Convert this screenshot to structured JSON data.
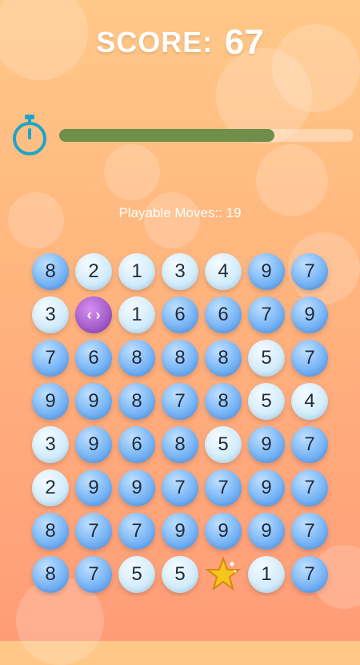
{
  "header": {
    "score_label": "SCORE:",
    "score_value": "67"
  },
  "timer": {
    "icon": "stopwatch-icon",
    "fill_fraction": 0.73,
    "fill_color": "#6e8e4a"
  },
  "moves": {
    "text": "Playable Moves:: 19"
  },
  "board": {
    "columns": 7,
    "rows": [
      [
        {
          "v": "8",
          "s": "dark"
        },
        {
          "v": "2",
          "s": "light"
        },
        {
          "v": "1",
          "s": "light"
        },
        {
          "v": "3",
          "s": "light"
        },
        {
          "v": "4",
          "s": "light"
        },
        {
          "v": "9",
          "s": "dark"
        },
        {
          "v": "7",
          "s": "dark"
        }
      ],
      [
        {
          "v": "3",
          "s": "light"
        },
        {
          "v": "‹ ›",
          "s": "special",
          "icon": "swap-arrows-icon"
        },
        {
          "v": "1",
          "s": "light"
        },
        {
          "v": "6",
          "s": "dark"
        },
        {
          "v": "6",
          "s": "dark"
        },
        {
          "v": "7",
          "s": "dark"
        },
        {
          "v": "9",
          "s": "dark"
        }
      ],
      [
        {
          "v": "7",
          "s": "dark"
        },
        {
          "v": "6",
          "s": "dark"
        },
        {
          "v": "8",
          "s": "dark"
        },
        {
          "v": "8",
          "s": "dark"
        },
        {
          "v": "8",
          "s": "dark"
        },
        {
          "v": "5",
          "s": "light"
        },
        {
          "v": "7",
          "s": "dark"
        }
      ],
      [
        {
          "v": "9",
          "s": "dark"
        },
        {
          "v": "9",
          "s": "dark"
        },
        {
          "v": "8",
          "s": "dark"
        },
        {
          "v": "7",
          "s": "dark"
        },
        {
          "v": "8",
          "s": "dark"
        },
        {
          "v": "5",
          "s": "light"
        },
        {
          "v": "4",
          "s": "light"
        }
      ],
      [
        {
          "v": "3",
          "s": "light"
        },
        {
          "v": "9",
          "s": "dark"
        },
        {
          "v": "6",
          "s": "dark"
        },
        {
          "v": "8",
          "s": "dark"
        },
        {
          "v": "5",
          "s": "light"
        },
        {
          "v": "9",
          "s": "dark"
        },
        {
          "v": "7",
          "s": "dark"
        }
      ],
      [
        {
          "v": "2",
          "s": "light"
        },
        {
          "v": "9",
          "s": "dark"
        },
        {
          "v": "9",
          "s": "dark"
        },
        {
          "v": "7",
          "s": "dark"
        },
        {
          "v": "7",
          "s": "dark"
        },
        {
          "v": "9",
          "s": "dark"
        },
        {
          "v": "7",
          "s": "dark"
        }
      ],
      [
        {
          "v": "8",
          "s": "dark"
        },
        {
          "v": "7",
          "s": "dark"
        },
        {
          "v": "7",
          "s": "dark"
        },
        {
          "v": "9",
          "s": "dark"
        },
        {
          "v": "9",
          "s": "dark"
        },
        {
          "v": "9",
          "s": "dark"
        },
        {
          "v": "7",
          "s": "dark"
        }
      ],
      [
        {
          "v": "8",
          "s": "dark"
        },
        {
          "v": "7",
          "s": "dark"
        },
        {
          "v": "5",
          "s": "light"
        },
        {
          "v": "5",
          "s": "light"
        },
        {
          "v": "",
          "s": "star",
          "icon": "star-icon"
        },
        {
          "v": "1",
          "s": "light"
        },
        {
          "v": "7",
          "s": "dark"
        }
      ]
    ]
  }
}
